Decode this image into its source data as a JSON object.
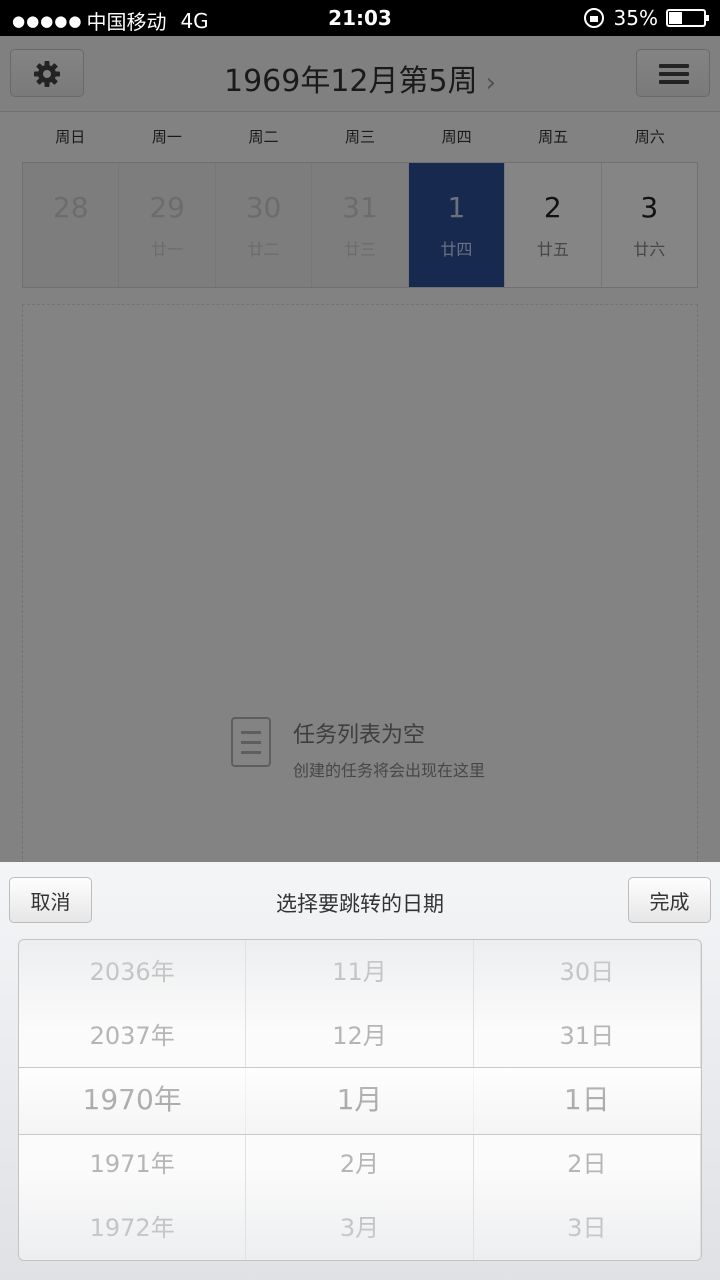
{
  "status_bar": {
    "signal": "●●●●●",
    "carrier": "中国移动",
    "network": "4G",
    "time": "21:03",
    "battery": "35%",
    "battery_level": 0.35
  },
  "nav": {
    "title": "1969年12月第5周",
    "settings_icon": "gear-icon",
    "menu_icon": "hamburger-icon"
  },
  "weekdays": [
    "周日",
    "周一",
    "周二",
    "周三",
    "周四",
    "周五",
    "周六"
  ],
  "dates": [
    {
      "day": "28",
      "lunar": ""
    },
    {
      "day": "29",
      "lunar": "廿一"
    },
    {
      "day": "30",
      "lunar": "廿二"
    },
    {
      "day": "31",
      "lunar": "廿三"
    },
    {
      "day": "1",
      "lunar": "廿四"
    },
    {
      "day": "2",
      "lunar": "廿五"
    },
    {
      "day": "3",
      "lunar": "廿六"
    }
  ],
  "empty_state": {
    "title": "任务列表为空",
    "subtitle": "创建的任务将会出现在这里"
  },
  "picker": {
    "cancel_label": "取消",
    "title": "选择要跳转的日期",
    "done_label": "完成",
    "years": [
      "2036年",
      "2037年",
      "1970年",
      "1971年",
      "1972年"
    ],
    "months": [
      "11月",
      "12月",
      "1月",
      "2月",
      "3月"
    ],
    "days": [
      "30日",
      "31日",
      "1日",
      "2日",
      "3日"
    ],
    "selected_index": 2
  },
  "colors": {
    "selected_day": "#2f4f9a",
    "overlay": "rgba(0,0,0,0.48)"
  }
}
